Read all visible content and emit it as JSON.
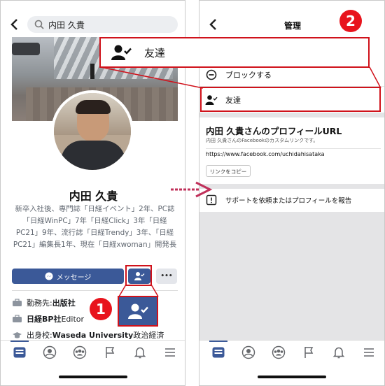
{
  "left": {
    "search_value": "内田 久貴",
    "name": "内田 久貴",
    "bio": "新卒入社後、専門誌「日経イベント」2年、PC誌「日経WinPC」7年「日経Click」3年「日経PC21」9年、流行誌「日経Trendy」3年、「日経PC21」編集長1年、現在「日経xwoman」開発長",
    "message_label": "メッセージ",
    "more_label": "•••",
    "info": [
      {
        "icon": "briefcase-icon",
        "prefix": "勤務先: ",
        "value": "出版社",
        "suffix": ""
      },
      {
        "icon": "briefcase-icon",
        "prefix": "",
        "value": "日経BP社",
        "suffix": " Editor"
      },
      {
        "icon": "graduation-cap-icon",
        "prefix": "出身校: ",
        "value": "Waseda University",
        "suffix": " 政治経済"
      }
    ]
  },
  "right": {
    "header_title": "管理",
    "block_label": "ブロックする",
    "friends_label": "友達",
    "url_title": "内田 久貴さんのプロフィールURL",
    "url_sub": "内田 久貴さんのFacebookのカスタムリンクです。",
    "url": "https://www.facebook.com/uchidahisataka",
    "copy_label": "リンクをコピー",
    "report_label": "サポートを依頼またはプロフィールを報告"
  },
  "callout": {
    "friends_label": "友達"
  },
  "step_numbers": [
    "1",
    "2"
  ],
  "colors": {
    "fb_blue": "#3b5998",
    "callout_red": "#d0121b",
    "badge_red": "#e8141d",
    "arrow_pink": "#c0305a",
    "gray_bg": "#e4e4e6"
  }
}
